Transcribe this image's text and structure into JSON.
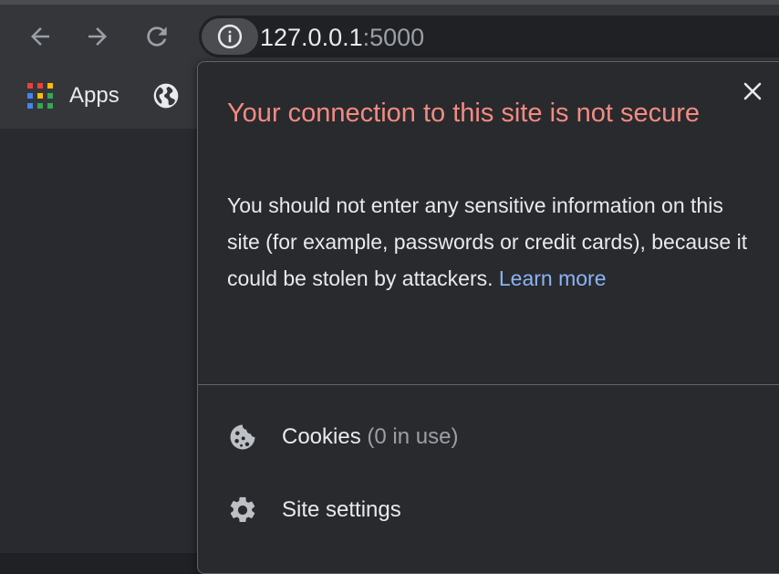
{
  "browser": {
    "url_host": "127.0.0.1",
    "url_port": ":5000",
    "icons": {
      "back": "arrow-left",
      "forward": "arrow-right",
      "reload": "reload",
      "site_info": "info-circle"
    }
  },
  "bookmarks": {
    "apps_label": "Apps",
    "apps_icon": "apps-grid",
    "globe_icon": "globe"
  },
  "popup": {
    "title": "Your connection to this site is not secure",
    "description": "You should not enter any sensitive information on this site (for example, passwords or credit cards), because it could be stolen by attackers.",
    "learn_more": "Learn more",
    "close_icon": "close",
    "items": [
      {
        "label": "Cookies",
        "detail": "(0 in use)",
        "icon": "cookie"
      },
      {
        "label": "Site settings",
        "detail": "",
        "icon": "gear"
      }
    ]
  },
  "colors": {
    "toolbar": "#35363a",
    "popup_bg": "#292a2d",
    "warning_title": "#f28b82",
    "link": "#8ab4f8"
  }
}
